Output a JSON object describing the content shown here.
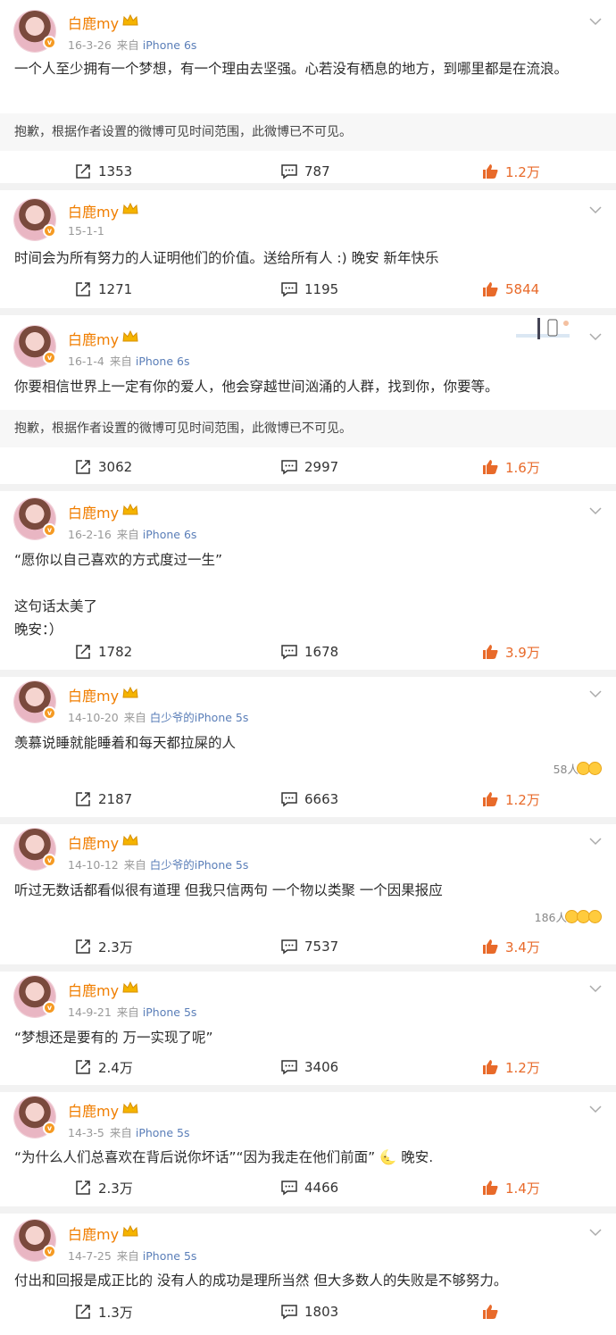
{
  "colors": {
    "name": "#f07e00",
    "like": "#e86a2a",
    "device": "#5a7eb8",
    "meta": "#999999"
  },
  "posts": [
    {
      "name": "白鹿my",
      "date": "16-3-26",
      "source_prefix": "来自",
      "device": "iPhone 6s",
      "text": "一个人至少拥有一个梦想，有一个理由去坚强。心若没有栖息的地方，到哪里都是在流浪。",
      "notice": "抱歉，根据作者设置的微博可见时间范围，此微博已不可见。",
      "reposts": "1353",
      "comments": "787",
      "likes": "1.2万"
    },
    {
      "name": "白鹿my",
      "date": "15-1-1",
      "source_prefix": "",
      "device": "",
      "text": "时间会为所有努力的人证明他们的价值。送给所有人 :) 晚安 新年快乐",
      "reposts": "1271",
      "comments": "1195",
      "likes": "5844"
    },
    {
      "name": "白鹿my",
      "date": "16-1-4",
      "source_prefix": "来自",
      "device": "iPhone 6s",
      "text": "你要相信世界上一定有你的爱人，他会穿越世间汹涌的人群，找到你，你要等。",
      "notice": "抱歉，根据作者设置的微博可见时间范围，此微博已不可见。",
      "reposts": "3062",
      "comments": "2997",
      "likes": "1.6万"
    },
    {
      "name": "白鹿my",
      "date": "16-2-16",
      "source_prefix": "来自",
      "device": "iPhone 6s",
      "text": "“愿你以自己喜欢的方式度过一生”\n\n这句话太美了\n晚安：）",
      "reposts": "1782",
      "comments": "1678",
      "likes": "3.9万"
    },
    {
      "name": "白鹿my",
      "date": "14-10-20",
      "source_prefix": "来自",
      "device": "白少爷的iPhone 5s",
      "text": "羡慕说睡就能睡着和每天都拉屎的人",
      "reaction_count": "58人",
      "reposts": "2187",
      "comments": "6663",
      "likes": "1.2万"
    },
    {
      "name": "白鹿my",
      "date": "14-10-12",
      "source_prefix": "来自",
      "device": "白少爷的iPhone 5s",
      "text": "听过无数话都看似很有道理 但我只信两句 一个物以类聚 一个因果报应",
      "reaction_count": "186人",
      "reposts": "2.3万",
      "comments": "7537",
      "likes": "3.4万"
    },
    {
      "name": "白鹿my",
      "date": "14-9-21",
      "source_prefix": "来自",
      "device": "iPhone 5s",
      "text": "“梦想还是要有的 万一实现了呢”",
      "reposts": "2.4万",
      "comments": "3406",
      "likes": "1.2万"
    },
    {
      "name": "白鹿my",
      "date": "14-3-5",
      "source_prefix": "来自",
      "device": "iPhone 5s",
      "text": "“为什么人们总喜欢在背后说你坏话”“因为我走在他们前面” 🌜 晚安.",
      "reposts": "2.3万",
      "comments": "4466",
      "likes": "1.4万"
    },
    {
      "name": "白鹿my",
      "date": "14-7-25",
      "source_prefix": "来自",
      "device": "iPhone 5s",
      "text": "付出和回报是成正比的 没有人的成功是理所当然 但大多数人的失败是不够努力。",
      "reposts": "1.3万",
      "comments": "1803",
      "likes": ""
    }
  ]
}
